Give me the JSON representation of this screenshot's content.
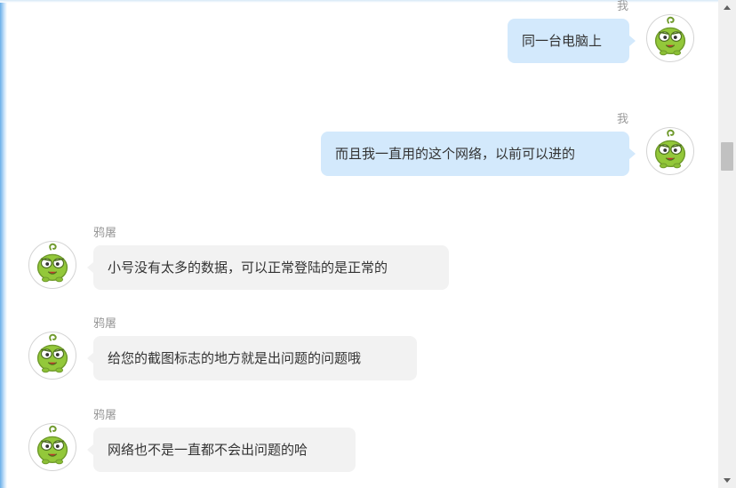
{
  "messages": [
    {
      "sender": "我",
      "text": "同一台电脑上"
    },
    {
      "sender": "我",
      "text": "而且我一直用的这个网络，以前可以进的"
    },
    {
      "sender": "鸦屠",
      "text": "小号没有太多的数据，可以正常登陆的是正常的"
    },
    {
      "sender": "鸦屠",
      "text": "给您的截图标志的地方就是出问题的问题哦"
    },
    {
      "sender": "鸦屠",
      "text": "网络也不是一直都不会出问题的哈"
    }
  ],
  "colors": {
    "self_bubble": "#d3e9fc",
    "other_bubble": "#f2f2f2",
    "avatar_green": "#93c83a",
    "name_text": "#9a9a9a"
  },
  "avatar_icon": "green-frog-cartoon-icon"
}
